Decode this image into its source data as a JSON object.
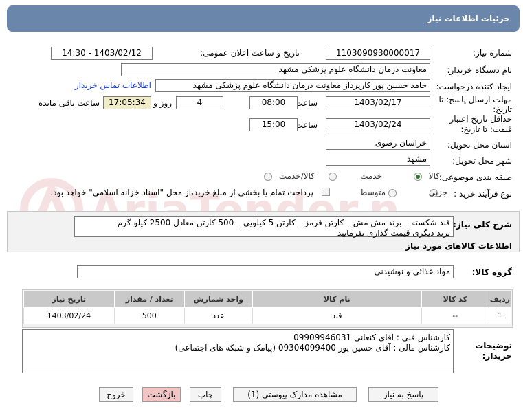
{
  "header": {
    "title": "جزئیات اطلاعات نیاز"
  },
  "labels": {
    "need_number": "شماره نیاز:",
    "announce_datetime": "تاریخ و ساعت اعلان عمومی:",
    "buyer_org": "نام دستگاه خریدار:",
    "requester": "ایجاد کننده درخواست:",
    "contact_link": "اطلاعات تماس خریدار",
    "reply_deadline_l1": "مهلت ارسال پاسخ: تا",
    "reply_deadline_l2": "تاریخ:",
    "hour": "ساعت",
    "hour2": "ساعت",
    "days_and": "روز و",
    "remaining": "ساعت باقی مانده",
    "validity_l1": "حداقل تاریخ اعتبار",
    "validity_l2": "قیمت: تا تاریخ:",
    "province": "استان محل تحویل:",
    "city": "شهر محل تحویل:",
    "category": "طبقه بندی موضوعی:",
    "purchase_type": "نوع فرآیند خرید :",
    "general_desc": "شرح کلی نیاز:",
    "goods_info": "اطلاعات کالاهای مورد نیاز",
    "goods_group": "گروه کالا:",
    "buyer_notes_l1": "توضیحات",
    "buyer_notes_l2": "خریدار:"
  },
  "values": {
    "need_number": "1103090930000017",
    "announce_datetime": "1403/02/12 - 14:30",
    "buyer_org": "معاونت درمان دانشگاه علوم پزشکی مشهد",
    "requester": "حامد حسین پور کارپرداز معاونت درمان دانشگاه علوم پزشکی مشهد",
    "reply_date": "1403/02/17",
    "reply_time": "08:00",
    "days": "4",
    "remaining_time": "17:05:34",
    "validity_date": "1403/02/24",
    "validity_time": "15:00",
    "province": "خراسان رضوی",
    "city": "مشهد",
    "goods_group": "مواد غذائی و نوشیدنی"
  },
  "category_options": {
    "goods": "کالا",
    "service": "خدمت",
    "goods_service": "کالا/خدمت"
  },
  "purchase_options": {
    "partial": "جزیی",
    "medium": "متوسط"
  },
  "payment_note": "پرداخت تمام یا بخشی از مبلغ خرید،از محل \"اسناد خزانه اسلامی\" خواهد بود.",
  "description": {
    "line1": "قند شکسته _ برند مش مش _ کارتن قرمز _ کارتن 5 کیلویی _ 500 کارتن معادل 2500 کیلو گرم",
    "line2": "برند دیگری قیمت گذاری نفرمایید"
  },
  "table": {
    "headers": [
      "ردیف",
      "کد کالا",
      "نام کالا",
      "واحد شمارش",
      "تعداد / مقدار",
      "تاریخ نیاز"
    ],
    "rows": [
      [
        "1",
        "--",
        "قند",
        "عدد",
        "500",
        "1403/02/24"
      ]
    ]
  },
  "buyer_notes": {
    "line1": "کارشناس فنی : آقای کنعانی 09909946031",
    "line2": "کارشناس مالی : آقای حسین پور 09304099400 (پیامک و شبکه های اجتماعی)"
  },
  "buttons": {
    "reply": "پاسخ به نیاز",
    "attachments": "مشاهده مدارک پیوستی (1)",
    "print": "چاپ",
    "back": "بازگشت",
    "exit": "خروج"
  },
  "watermark": {
    "text": "AriaTender.net"
  }
}
